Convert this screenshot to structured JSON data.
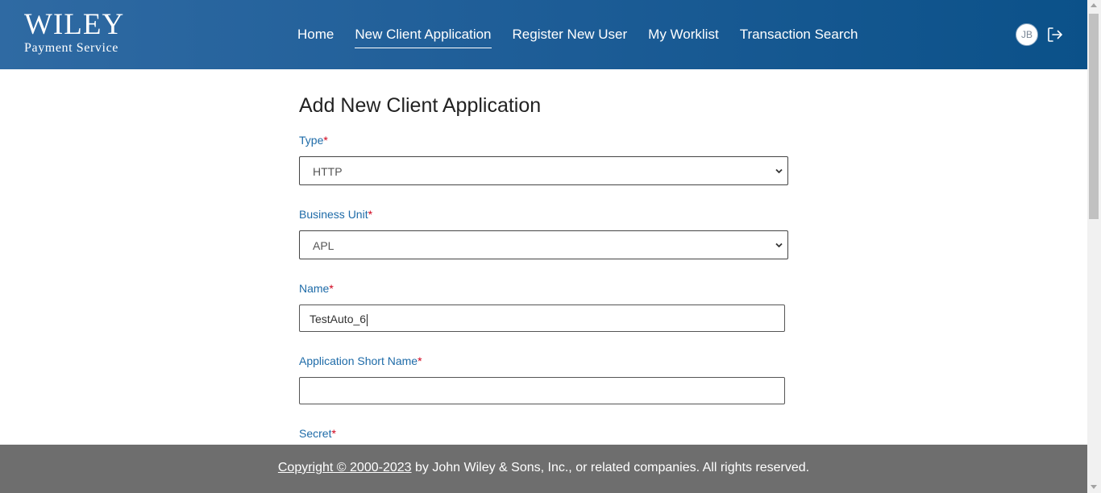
{
  "header": {
    "logo_main": "WILEY",
    "logo_sub": "Payment Service",
    "nav": [
      {
        "label": "Home"
      },
      {
        "label": "New Client Application"
      },
      {
        "label": "Register New User"
      },
      {
        "label": "My Worklist"
      },
      {
        "label": "Transaction Search"
      }
    ],
    "active_nav": "New Client Application",
    "avatar_initials": "JB",
    "logout_icon": "logout-icon"
  },
  "form": {
    "title": "Add New Client Application",
    "required_marker": "*",
    "type": {
      "label": "Type",
      "value": "HTTP"
    },
    "business_unit": {
      "label": "Business Unit",
      "value": "APL"
    },
    "name": {
      "label": "Name",
      "value": "TestAuto_6"
    },
    "short_name": {
      "label": "Application Short Name",
      "value": ""
    },
    "secret": {
      "label": "Secret"
    }
  },
  "footer": {
    "copyright_link": "Copyright © 2000-2023",
    "copyright_rest": " by John Wiley & Sons, Inc., or related companies. All rights reserved."
  },
  "colors": {
    "header_gradient_start": "#2f6aa3",
    "header_gradient_end": "#0b5189",
    "label_blue": "#1e6ba8",
    "required_red": "#d0021b",
    "footer_gray": "#6e6e6e"
  }
}
